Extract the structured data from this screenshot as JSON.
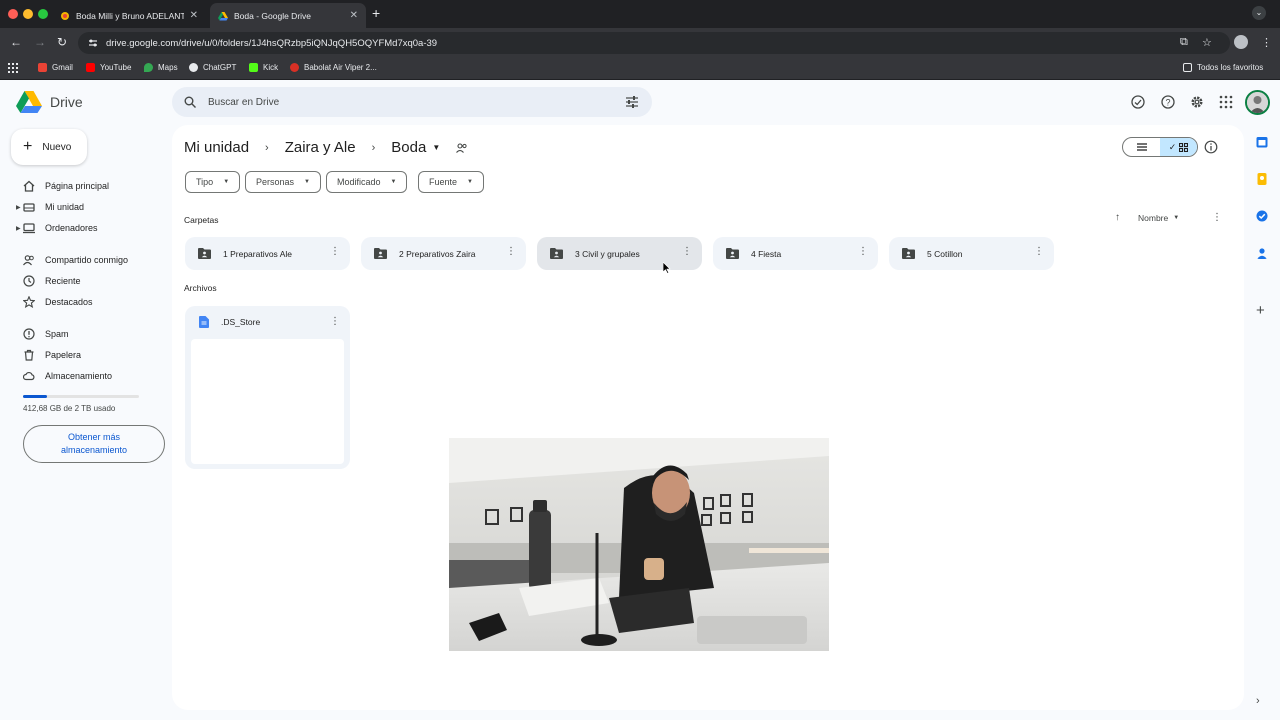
{
  "browser": {
    "tabs": [
      {
        "title": "Boda Milli y Bruno ADELANTO",
        "active": false
      },
      {
        "title": "Boda - Google Drive",
        "active": true
      }
    ],
    "url": "drive.google.com/drive/u/0/folders/1J4hsQRzbp5iQNJqQH5OQYFMd7xq0a-39",
    "bookmarks": [
      "Gmail",
      "YouTube",
      "Maps",
      "ChatGPT",
      "Kick",
      "Babolat Air Viper 2..."
    ],
    "all_bookmarks": "Todos los favoritos"
  },
  "drive": {
    "app_name": "Drive",
    "search_placeholder": "Buscar en Drive",
    "new_button": "Nuevo",
    "nav": [
      {
        "label": "Página principal",
        "icon": "home-icon"
      },
      {
        "label": "Mi unidad",
        "icon": "drive-icon"
      },
      {
        "label": "Ordenadores",
        "icon": "computer-icon"
      },
      {
        "label": "Compartido conmigo",
        "icon": "people-icon"
      },
      {
        "label": "Reciente",
        "icon": "clock-icon"
      },
      {
        "label": "Destacados",
        "icon": "star-icon"
      },
      {
        "label": "Spam",
        "icon": "spam-icon"
      },
      {
        "label": "Papelera",
        "icon": "trash-icon"
      },
      {
        "label": "Almacenamiento",
        "icon": "cloud-icon"
      }
    ],
    "storage": {
      "text": "412,68 GB de 2 TB usado",
      "fraction": 0.206
    },
    "get_more_storage": "Obtener más almacenamiento",
    "breadcrumb": [
      "Mi unidad",
      "Zaira y Ale",
      "Boda"
    ],
    "filters": [
      "Tipo",
      "Personas",
      "Modificado",
      "Fuente"
    ],
    "sections": {
      "folders": "Carpetas",
      "files": "Archivos"
    },
    "sort_label": "Nombre",
    "folders": [
      "1 Preparativos Ale",
      "2 Preparativos Zaira",
      "3 Civil y grupales",
      "4 Fiesta",
      "5 Cotillon"
    ],
    "files": [
      ".DS_Store"
    ]
  },
  "colors": {
    "accent": "#0b57d0",
    "selected": "#c2e7ff",
    "surface": "#f0f4f9"
  }
}
